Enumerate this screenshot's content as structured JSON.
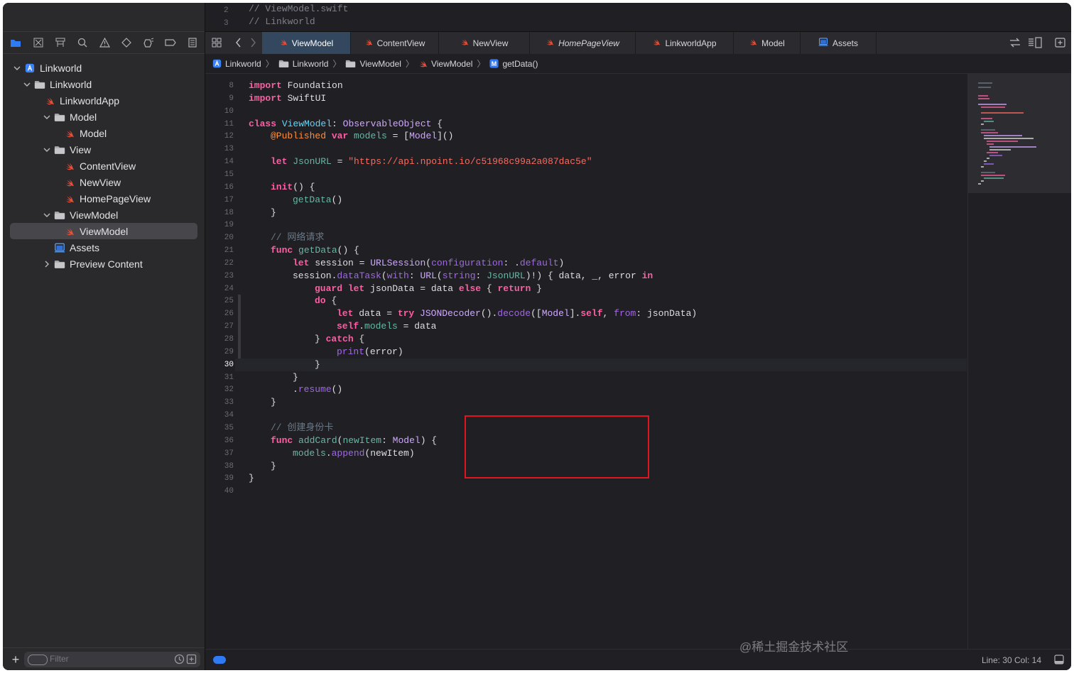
{
  "header_comments": [
    {
      "num": "2",
      "text": "//  ViewModel.swift"
    },
    {
      "num": "3",
      "text": "//  Linkworld"
    }
  ],
  "navigator_icons": [
    "folder-icon",
    "source-control-icon",
    "hierarchy-icon",
    "search-icon",
    "warning-icon",
    "test-icon",
    "debug-icon",
    "breakpoint-icon",
    "report-icon"
  ],
  "tree": [
    {
      "label": "Linkworld",
      "name": "tree-item-linkworld-project",
      "icon": "project-icon",
      "disclosure": "open"
    },
    {
      "label": "Linkworld",
      "name": "tree-item-linkworld-folder",
      "icon": "folder-icon",
      "disclosure": "open"
    },
    {
      "label": "LinkworldApp",
      "name": "tree-item-linkworldapp",
      "icon": "swift-file-icon",
      "disclosure": ""
    },
    {
      "label": "Model",
      "name": "tree-item-model-folder",
      "icon": "folder-icon",
      "disclosure": "open"
    },
    {
      "label": "Model",
      "name": "tree-item-model-file",
      "icon": "swift-file-icon",
      "disclosure": ""
    },
    {
      "label": "View",
      "name": "tree-item-view-folder",
      "icon": "folder-icon",
      "disclosure": "open"
    },
    {
      "label": "ContentView",
      "name": "tree-item-contentview",
      "icon": "swift-file-icon",
      "disclosure": ""
    },
    {
      "label": "NewView",
      "name": "tree-item-newview",
      "icon": "swift-file-icon",
      "disclosure": ""
    },
    {
      "label": "HomePageView",
      "name": "tree-item-homepageview",
      "icon": "swift-file-icon",
      "disclosure": ""
    },
    {
      "label": "ViewModel",
      "name": "tree-item-viewmodel-folder",
      "icon": "folder-icon",
      "disclosure": "open"
    },
    {
      "label": "ViewModel",
      "name": "tree-item-viewmodel-file",
      "icon": "swift-file-icon",
      "disclosure": "",
      "selected": true
    },
    {
      "label": "Assets",
      "name": "tree-item-assets",
      "icon": "assets-icon",
      "disclosure": ""
    },
    {
      "label": "Preview Content",
      "name": "tree-item-preview-content",
      "icon": "folder-icon",
      "disclosure": "closed"
    }
  ],
  "filter": {
    "placeholder": "Filter",
    "add": "+"
  },
  "tabs": [
    {
      "label": "ViewModel",
      "active": true,
      "italic": false,
      "icon": "swift-file-icon"
    },
    {
      "label": "ContentView",
      "active": false,
      "italic": false,
      "icon": "swift-file-icon"
    },
    {
      "label": "NewView",
      "active": false,
      "italic": false,
      "icon": "swift-file-icon"
    },
    {
      "label": "HomePageView",
      "active": false,
      "italic": true,
      "icon": "swift-file-icon"
    },
    {
      "label": "LinkworldApp",
      "active": false,
      "italic": false,
      "icon": "swift-file-icon"
    },
    {
      "label": "Model",
      "active": false,
      "italic": false,
      "icon": "swift-file-icon"
    },
    {
      "label": "Assets",
      "active": false,
      "italic": false,
      "icon": "assets-icon"
    }
  ],
  "breadcrumb": [
    {
      "label": "Linkworld",
      "icon": "project-icon"
    },
    {
      "label": "Linkworld",
      "icon": "folder-icon"
    },
    {
      "label": "ViewModel",
      "icon": "folder-icon"
    },
    {
      "label": "ViewModel",
      "icon": "swift-file-icon"
    },
    {
      "label": "getData()",
      "icon": "method-icon",
      "icon_glyph": "M"
    }
  ],
  "current_line": 30,
  "code": [
    {
      "n": 8,
      "indent": 0,
      "tokens": [
        [
          "kw",
          "import"
        ],
        [
          "",
          "Foundation"
        ]
      ]
    },
    {
      "n": 9,
      "indent": 0,
      "tokens": [
        [
          "kw",
          "import"
        ],
        [
          "",
          "SwiftUI"
        ]
      ]
    },
    {
      "n": 10,
      "indent": 0,
      "tokens": []
    },
    {
      "n": 11,
      "indent": 0,
      "tokens": [
        [
          "kw",
          "class"
        ],
        [
          "tyd",
          " ViewModel"
        ],
        [
          "",
          ":"
        ],
        [
          "ty",
          " ObservableObject"
        ],
        [
          "",
          " {"
        ]
      ]
    },
    {
      "n": 12,
      "indent": 1,
      "tokens": [
        [
          "at",
          "@Published"
        ],
        [
          "kw",
          " var"
        ],
        [
          "fn",
          " models"
        ],
        [
          "",
          " = ["
        ],
        [
          "ty",
          "Model"
        ],
        [
          "",
          "]()"
        ]
      ]
    },
    {
      "n": 13,
      "indent": 0,
      "tokens": []
    },
    {
      "n": 14,
      "indent": 1,
      "tokens": [
        [
          "kw",
          "let"
        ],
        [
          "fn",
          " JsonURL"
        ],
        [
          "",
          " = "
        ],
        [
          "st",
          "\"https://api.npoint.io/c51968c99a2a087dac5e\""
        ]
      ]
    },
    {
      "n": 15,
      "indent": 0,
      "tokens": []
    },
    {
      "n": 16,
      "indent": 1,
      "tokens": [
        [
          "kw",
          "init"
        ],
        [
          "",
          "() {"
        ]
      ]
    },
    {
      "n": 17,
      "indent": 2,
      "tokens": [
        [
          "fn",
          "getData"
        ],
        [
          "",
          "()"
        ]
      ]
    },
    {
      "n": 18,
      "indent": 1,
      "tokens": [
        [
          "",
          "}"
        ]
      ]
    },
    {
      "n": 19,
      "indent": 0,
      "tokens": []
    },
    {
      "n": 20,
      "indent": 1,
      "tokens": [
        [
          "cm",
          "// 网络请求"
        ]
      ]
    },
    {
      "n": 21,
      "indent": 1,
      "tokens": [
        [
          "kw",
          "func"
        ],
        [
          "fn",
          " getData"
        ],
        [
          "",
          "() {"
        ]
      ]
    },
    {
      "n": 22,
      "indent": 2,
      "tokens": [
        [
          "kw",
          "let"
        ],
        [
          "",
          " session = "
        ],
        [
          "ty",
          "URLSession"
        ],
        [
          "",
          "("
        ],
        [
          "me",
          "configuration"
        ],
        [
          "",
          ": ."
        ],
        [
          "me",
          "default"
        ],
        [
          "",
          ")"
        ]
      ]
    },
    {
      "n": 23,
      "indent": 2,
      "tokens": [
        [
          "",
          "session."
        ],
        [
          "me",
          "dataTask"
        ],
        [
          "",
          "("
        ],
        [
          "me",
          "with"
        ],
        [
          "",
          ": "
        ],
        [
          "ty",
          "URL"
        ],
        [
          "",
          "("
        ],
        [
          "me",
          "string"
        ],
        [
          "",
          ": "
        ],
        [
          "fn",
          "JsonURL"
        ],
        [
          "",
          ")!) { data, _, error "
        ],
        [
          "kw",
          "in"
        ]
      ]
    },
    {
      "n": 24,
      "indent": 3,
      "tokens": [
        [
          "kw",
          "guard"
        ],
        [
          "kw",
          " let"
        ],
        [
          "",
          " jsonData = data "
        ],
        [
          "kw",
          "else"
        ],
        [
          "",
          " { "
        ],
        [
          "kw",
          "return"
        ],
        [
          "",
          " }"
        ]
      ]
    },
    {
      "n": 25,
      "indent": 3,
      "tokens": [
        [
          "kw",
          "do"
        ],
        [
          "",
          " {"
        ]
      ]
    },
    {
      "n": 26,
      "indent": 4,
      "tokens": [
        [
          "kw",
          "let"
        ],
        [
          "",
          " data = "
        ],
        [
          "kw",
          "try"
        ],
        [
          "ty",
          " JSONDecoder"
        ],
        [
          "",
          "()."
        ],
        [
          "me",
          "decode"
        ],
        [
          "",
          "(["
        ],
        [
          "ty",
          "Model"
        ],
        [
          "",
          "]."
        ],
        [
          "kw",
          "self"
        ],
        [
          "",
          ", "
        ],
        [
          "me",
          "from"
        ],
        [
          "",
          ": jsonData)"
        ]
      ]
    },
    {
      "n": 27,
      "indent": 4,
      "tokens": [
        [
          "kw",
          "self"
        ],
        [
          "",
          "."
        ],
        [
          "fn",
          "models"
        ],
        [
          "",
          " = data"
        ]
      ]
    },
    {
      "n": 28,
      "indent": 3,
      "tokens": [
        [
          "",
          "} "
        ],
        [
          "kw",
          "catch"
        ],
        [
          "",
          " {"
        ]
      ]
    },
    {
      "n": 29,
      "indent": 4,
      "tokens": [
        [
          "me",
          "print"
        ],
        [
          "",
          "(error)"
        ]
      ]
    },
    {
      "n": 30,
      "indent": 3,
      "tokens": [
        [
          "",
          "}"
        ]
      ]
    },
    {
      "n": 31,
      "indent": 2,
      "tokens": [
        [
          "",
          "}"
        ]
      ]
    },
    {
      "n": 32,
      "indent": 2,
      "tokens": [
        [
          "",
          "."
        ],
        [
          "me",
          "resume"
        ],
        [
          "",
          "()"
        ]
      ]
    },
    {
      "n": 33,
      "indent": 1,
      "tokens": [
        [
          "",
          "}"
        ]
      ]
    },
    {
      "n": 34,
      "indent": 0,
      "tokens": []
    },
    {
      "n": 35,
      "indent": 1,
      "tokens": [
        [
          "cm",
          "// 创建身份卡"
        ]
      ]
    },
    {
      "n": 36,
      "indent": 1,
      "tokens": [
        [
          "kw",
          "func"
        ],
        [
          "fn",
          " addCard"
        ],
        [
          "",
          "("
        ],
        [
          "fn",
          "newItem"
        ],
        [
          "",
          ": "
        ],
        [
          "ty",
          "Model"
        ],
        [
          "",
          ") {"
        ]
      ]
    },
    {
      "n": 37,
      "indent": 2,
      "tokens": [
        [
          "fn",
          "models"
        ],
        [
          "",
          "."
        ],
        [
          "me",
          "append"
        ],
        [
          "",
          "(newItem)"
        ]
      ]
    },
    {
      "n": 38,
      "indent": 1,
      "tokens": [
        [
          "",
          "}"
        ]
      ]
    },
    {
      "n": 39,
      "indent": 0,
      "tokens": [
        [
          "",
          "}"
        ]
      ]
    },
    {
      "n": 40,
      "indent": 0,
      "tokens": []
    }
  ],
  "status": {
    "position": "Line: 30  Col: 14"
  },
  "watermark": "@稀土掘金技术社区",
  "colors": {
    "accent": "#2f7bf5",
    "swift": "#f05138",
    "highlight_box": "#e0151d",
    "keyword": "#fc5fa3",
    "string": "#fc6a5d",
    "comment": "#6c7986"
  }
}
